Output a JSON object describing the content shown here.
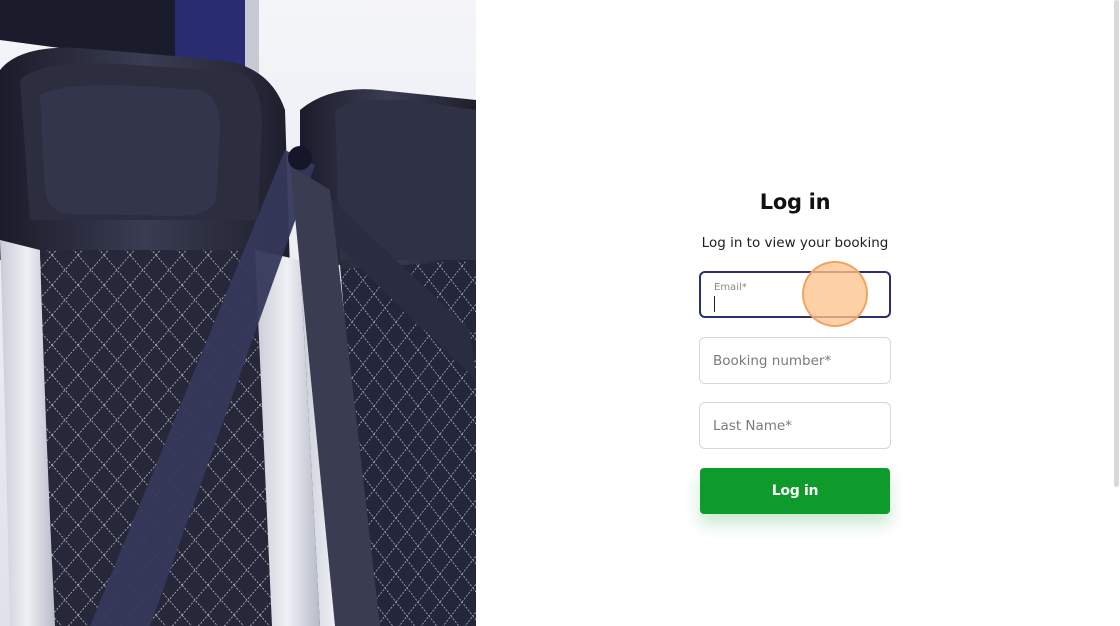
{
  "hero_image": {
    "description_icon": "bus-seat-photo"
  },
  "login": {
    "title": "Log in",
    "subtitle": "Log in to view your booking",
    "email": {
      "label": "Email*",
      "value": ""
    },
    "booking_number": {
      "placeholder": "Booking number*",
      "value": ""
    },
    "last_name": {
      "placeholder": "Last Name*",
      "value": ""
    },
    "submit_label": "Log in"
  },
  "colors": {
    "primary_button": "#0f9a2c",
    "focused_border": "#2b2e73",
    "click_indicator": "#fcc48c"
  }
}
